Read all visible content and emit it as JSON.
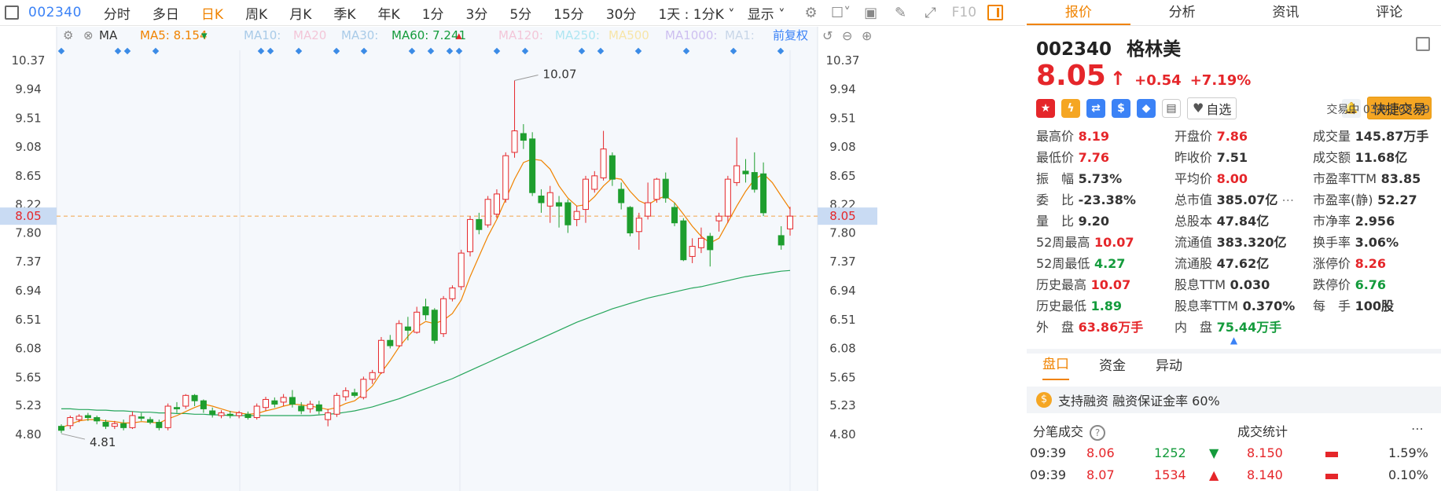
{
  "toolbar": {
    "code": "002340",
    "items": [
      "分时",
      "多日",
      "日K",
      "周K",
      "月K",
      "季K",
      "年K",
      "1分",
      "3分",
      "5分",
      "15分",
      "30分"
    ],
    "active": "日K",
    "interval": "1天 : 1分K",
    "display": "显示",
    "f10": "F10"
  },
  "ma_bar": {
    "ma_label": "MA",
    "ma5": "MA5: 8.154",
    "ma5_color": "#f08300",
    "ma10": "MA10:",
    "ma20": "MA20",
    "ma30": "MA30:",
    "ma60": "MA60: 7.241",
    "ma60_color": "#149b3c",
    "ma120": "MA120:",
    "ma250": "MA250:",
    "ma500": "MA500",
    "ma1000": "MA1000:",
    "ma1": "MA1:",
    "adjust": "前复权"
  },
  "chart_data": {
    "type": "candlestick",
    "y_ticks": [
      "10.37",
      "9.94",
      "9.51",
      "9.08",
      "8.65",
      "8.22",
      "7.80",
      "7.37",
      "6.94",
      "6.51",
      "6.08",
      "5.65",
      "5.23",
      "4.80"
    ],
    "current_price_label": "8.05",
    "high_label": "10.07",
    "low_label": "4.81",
    "ylim": [
      4.6,
      10.45
    ],
    "candles": [
      [
        4.92,
        4.86,
        4.95,
        4.82
      ],
      [
        4.93,
        5.05,
        5.08,
        4.88
      ],
      [
        5.02,
        5.07,
        5.1,
        4.98
      ],
      [
        5.08,
        5.05,
        5.12,
        5.0
      ],
      [
        5.05,
        5.0,
        5.08,
        4.95
      ],
      [
        4.98,
        4.92,
        5.02,
        4.88
      ],
      [
        4.92,
        4.96,
        5.0,
        4.88
      ],
      [
        4.96,
        4.9,
        5.02,
        4.86
      ],
      [
        4.9,
        5.08,
        5.14,
        4.88
      ],
      [
        5.06,
        5.04,
        5.12,
        5.0
      ],
      [
        5.02,
        4.98,
        5.06,
        4.95
      ],
      [
        4.98,
        4.9,
        5.02,
        4.86
      ],
      [
        4.9,
        5.22,
        5.26,
        4.86
      ],
      [
        5.2,
        5.18,
        5.28,
        5.12
      ],
      [
        5.22,
        5.38,
        5.4,
        5.18
      ],
      [
        5.38,
        5.3,
        5.4,
        5.22
      ],
      [
        5.3,
        5.18,
        5.32,
        5.12
      ],
      [
        5.15,
        5.1,
        5.2,
        5.05
      ],
      [
        5.08,
        5.12,
        5.16,
        5.04
      ],
      [
        5.1,
        5.08,
        5.15,
        5.04
      ],
      [
        5.08,
        5.12,
        5.15,
        5.04
      ],
      [
        5.1,
        5.05,
        5.14,
        5.02
      ],
      [
        5.05,
        5.22,
        5.26,
        5.02
      ],
      [
        5.2,
        5.32,
        5.36,
        5.15
      ],
      [
        5.3,
        5.25,
        5.35,
        5.2
      ],
      [
        5.28,
        5.35,
        5.4,
        5.22
      ],
      [
        5.35,
        5.25,
        5.46,
        5.2
      ],
      [
        5.22,
        5.15,
        5.28,
        5.1
      ],
      [
        5.18,
        5.25,
        5.3,
        5.12
      ],
      [
        5.24,
        5.15,
        5.3,
        5.1
      ],
      [
        5.02,
        5.12,
        5.18,
        4.92
      ],
      [
        5.1,
        5.38,
        5.42,
        5.06
      ],
      [
        5.36,
        5.45,
        5.5,
        5.3
      ],
      [
        5.42,
        5.38,
        5.48,
        5.35
      ],
      [
        5.35,
        5.62,
        5.66,
        5.32
      ],
      [
        5.62,
        5.72,
        5.76,
        5.55
      ],
      [
        5.72,
        6.2,
        6.25,
        5.7
      ],
      [
        6.2,
        6.12,
        6.28,
        6.08
      ],
      [
        6.12,
        6.45,
        6.5,
        6.1
      ],
      [
        6.4,
        6.35,
        6.55,
        6.2
      ],
      [
        6.32,
        6.62,
        6.7,
        6.3
      ],
      [
        6.7,
        6.58,
        6.82,
        6.5
      ],
      [
        6.65,
        6.2,
        6.68,
        6.15
      ],
      [
        6.3,
        6.82,
        6.86,
        6.25
      ],
      [
        6.82,
        6.98,
        7.02,
        6.78
      ],
      [
        7.0,
        7.5,
        7.55,
        6.95
      ],
      [
        7.52,
        8.0,
        8.05,
        7.45
      ],
      [
        8.0,
        7.85,
        8.1,
        7.78
      ],
      [
        7.92,
        8.3,
        8.35,
        7.88
      ],
      [
        8.08,
        8.38,
        8.45,
        8.02
      ],
      [
        8.3,
        8.95,
        9.0,
        8.25
      ],
      [
        9.0,
        9.32,
        10.07,
        8.92
      ],
      [
        9.28,
        9.18,
        9.42,
        9.05
      ],
      [
        9.2,
        8.4,
        9.3,
        8.35
      ],
      [
        8.35,
        8.25,
        8.45,
        8.1
      ],
      [
        8.2,
        8.4,
        8.5,
        7.95
      ],
      [
        8.25,
        8.2,
        8.35,
        7.88
      ],
      [
        8.25,
        7.92,
        8.3,
        7.8
      ],
      [
        8.0,
        8.12,
        8.2,
        7.9
      ],
      [
        8.15,
        8.6,
        8.65,
        7.95
      ],
      [
        8.45,
        8.65,
        8.72,
        8.4
      ],
      [
        8.62,
        9.05,
        9.32,
        8.58
      ],
      [
        8.95,
        8.6,
        9.0,
        8.5
      ],
      [
        8.45,
        8.25,
        8.55,
        8.15
      ],
      [
        8.18,
        7.8,
        8.2,
        7.75
      ],
      [
        7.82,
        8.02,
        8.1,
        7.55
      ],
      [
        8.05,
        8.25,
        8.55,
        8.0
      ],
      [
        8.3,
        8.6,
        8.62,
        8.25
      ],
      [
        8.6,
        8.32,
        8.7,
        8.25
      ],
      [
        8.18,
        7.95,
        8.25,
        7.9
      ],
      [
        7.98,
        7.4,
        8.02,
        7.38
      ],
      [
        7.45,
        7.6,
        7.72,
        7.35
      ],
      [
        7.58,
        7.72,
        7.88,
        7.5
      ],
      [
        7.75,
        7.55,
        7.8,
        7.3
      ],
      [
        7.98,
        8.05,
        8.1,
        7.82
      ],
      [
        8.05,
        8.6,
        8.65,
        7.95
      ],
      [
        8.55,
        8.8,
        9.22,
        8.5
      ],
      [
        8.72,
        8.68,
        8.9,
        8.55
      ],
      [
        8.7,
        8.45,
        9.0,
        8.4
      ],
      [
        8.68,
        8.1,
        8.85,
        8.05
      ],
      null,
      [
        7.76,
        7.62,
        7.9,
        7.55
      ],
      [
        7.86,
        8.05,
        8.19,
        7.76
      ]
    ],
    "ma5": [
      4.9,
      4.95,
      5.0,
      5.02,
      5.02,
      5.0,
      4.99,
      4.97,
      4.97,
      4.99,
      4.98,
      4.97,
      5.03,
      5.08,
      5.14,
      5.2,
      5.25,
      5.22,
      5.18,
      5.14,
      5.12,
      5.1,
      5.11,
      5.15,
      5.18,
      5.22,
      5.25,
      5.24,
      5.22,
      5.2,
      5.17,
      5.2,
      5.26,
      5.3,
      5.4,
      5.52,
      5.72,
      5.9,
      6.1,
      6.26,
      6.4,
      6.48,
      6.45,
      6.5,
      6.6,
      6.8,
      7.15,
      7.45,
      7.75,
      8.0,
      8.3,
      8.6,
      8.85,
      8.9,
      8.88,
      8.75,
      8.5,
      8.32,
      8.2,
      8.22,
      8.34,
      8.5,
      8.62,
      8.6,
      8.42,
      8.28,
      8.22,
      8.3,
      8.35,
      8.25,
      8.08,
      7.9,
      7.75,
      7.65,
      7.72,
      7.96,
      8.2,
      8.42,
      8.6,
      8.68,
      8.55,
      8.35,
      8.154
    ],
    "ma60": [
      5.18,
      5.18,
      5.17,
      5.17,
      5.16,
      5.16,
      5.15,
      5.15,
      5.14,
      5.13,
      5.13,
      5.12,
      5.12,
      5.11,
      5.11,
      5.1,
      5.1,
      5.09,
      5.09,
      5.08,
      5.08,
      5.08,
      5.08,
      5.08,
      5.08,
      5.08,
      5.08,
      5.08,
      5.08,
      5.09,
      5.1,
      5.11,
      5.13,
      5.15,
      5.18,
      5.21,
      5.25,
      5.29,
      5.33,
      5.38,
      5.43,
      5.48,
      5.53,
      5.58,
      5.63,
      5.69,
      5.75,
      5.81,
      5.87,
      5.93,
      5.99,
      6.05,
      6.11,
      6.17,
      6.23,
      6.29,
      6.35,
      6.41,
      6.47,
      6.52,
      6.57,
      6.62,
      6.67,
      6.71,
      6.75,
      6.79,
      6.83,
      6.86,
      6.89,
      6.92,
      6.95,
      6.98,
      7.0,
      7.03,
      7.06,
      7.09,
      7.12,
      7.15,
      7.17,
      7.19,
      7.21,
      7.23,
      7.241
    ]
  },
  "quote": {
    "code": "002340",
    "name": "格林美",
    "price": "8.05",
    "arrow": "↑",
    "change": "+0.54",
    "pct": "+7.19%",
    "status": "交易中 03/01 09:39",
    "watch": "自选",
    "quick_trade": "快捷交易",
    "stats": [
      [
        {
          "k": "最高价",
          "v": "8.19",
          "c": "up"
        },
        {
          "k": "开盘价",
          "v": "7.86",
          "c": "up"
        },
        {
          "k": "成交量",
          "v": "145.87万手",
          "c": ""
        }
      ],
      [
        {
          "k": "最低价",
          "v": "7.76",
          "c": "up"
        },
        {
          "k": "昨收价",
          "v": "7.51",
          "c": ""
        },
        {
          "k": "成交额",
          "v": "11.68亿",
          "c": ""
        }
      ],
      [
        {
          "k": "振　幅",
          "v": "5.73%",
          "c": ""
        },
        {
          "k": "平均价",
          "v": "8.00",
          "c": "up"
        },
        {
          "k": "市盈率TTM",
          "v": "83.85",
          "c": ""
        }
      ],
      [
        {
          "k": "委　比",
          "v": "-23.38%",
          "c": ""
        },
        {
          "k": "总市值",
          "v": "385.07亿",
          "c": ""
        },
        {
          "k": "市盈率(静)",
          "v": "52.27",
          "c": ""
        }
      ],
      [
        {
          "k": "量　比",
          "v": "9.20",
          "c": ""
        },
        {
          "k": "总股本",
          "v": "47.84亿",
          "c": ""
        },
        {
          "k": "市净率",
          "v": "2.956",
          "c": ""
        }
      ],
      [
        {
          "k": "52周最高",
          "v": "10.07",
          "c": "up"
        },
        {
          "k": "流通值",
          "v": "383.320亿",
          "c": ""
        },
        {
          "k": "换手率",
          "v": "3.06%",
          "c": ""
        }
      ],
      [
        {
          "k": "52周最低",
          "v": "4.27",
          "c": "dn"
        },
        {
          "k": "流通股",
          "v": "47.62亿",
          "c": ""
        },
        {
          "k": "涨停价",
          "v": "8.26",
          "c": "up"
        }
      ],
      [
        {
          "k": "历史最高",
          "v": "10.07",
          "c": "up"
        },
        {
          "k": "股息TTM",
          "v": "0.030",
          "c": ""
        },
        {
          "k": "跌停价",
          "v": "6.76",
          "c": "dn"
        }
      ],
      [
        {
          "k": "历史最低",
          "v": "1.89",
          "c": "dn"
        },
        {
          "k": "股息率TTM",
          "v": "0.370%",
          "c": ""
        },
        {
          "k": "每　手",
          "v": "100股",
          "c": ""
        }
      ],
      [
        {
          "k": "外　盘",
          "v": "63.86万手",
          "c": "up"
        },
        {
          "k": "内　盘",
          "v": "75.44万手",
          "c": "dn"
        },
        {
          "k": "",
          "v": "",
          "c": ""
        }
      ]
    ]
  },
  "right_tabs": [
    "报价",
    "分析",
    "资讯",
    "评论"
  ],
  "sub_tabs": [
    "盘口",
    "资金",
    "异动"
  ],
  "margin_text": "支持融资 融资保证金率 60%",
  "trade": {
    "title": "分笔成交",
    "stat_title": "成交统计",
    "rows": [
      [
        "09:39",
        "8.06",
        "1252",
        "8.150",
        "1.59%"
      ],
      [
        "09:39",
        "8.07",
        "1534",
        "8.140",
        "0.10%"
      ]
    ]
  }
}
